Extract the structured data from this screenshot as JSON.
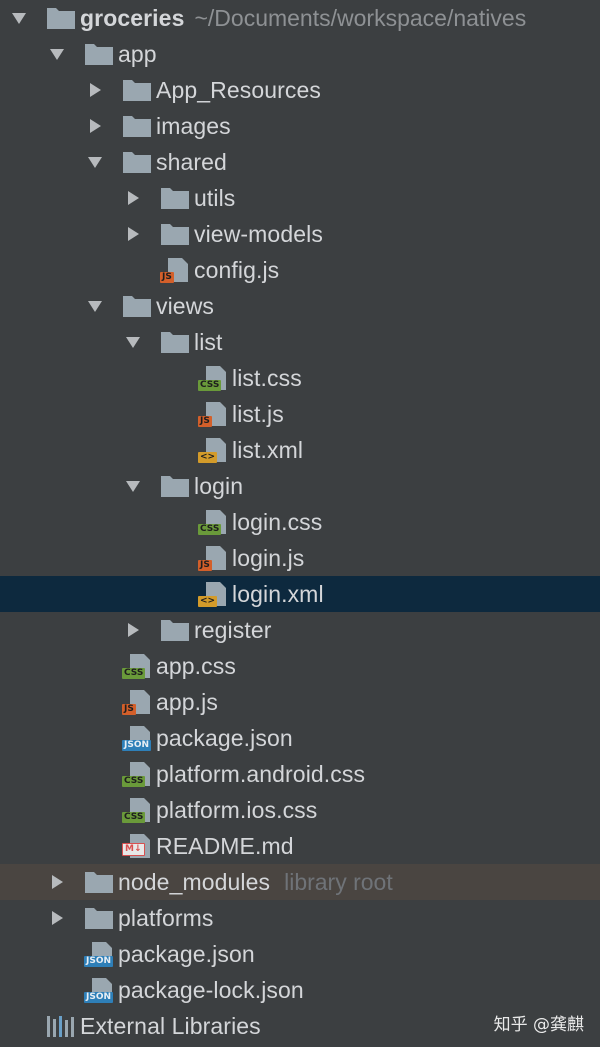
{
  "colors": {
    "background": "#3c3f41",
    "selected_row": "#0d293e",
    "library_root_row": "#4a4541",
    "folder": "#9aa7b0",
    "css_badge": "#6a9a3a",
    "js_badge": "#d35f2a",
    "xml_badge": "#d39b2a",
    "json_badge": "#2e7fb8",
    "md_badge": "#d85050"
  },
  "project": {
    "name": "groceries",
    "path": "~/Documents/workspace/natives"
  },
  "tree": [
    {
      "label": "app",
      "icon": "folder-icon",
      "expanded": true
    },
    {
      "label": "App_Resources",
      "icon": "folder-icon",
      "expanded": false
    },
    {
      "label": "images",
      "icon": "folder-icon",
      "expanded": false
    },
    {
      "label": "shared",
      "icon": "folder-icon",
      "expanded": true
    },
    {
      "label": "utils",
      "icon": "folder-icon",
      "expanded": false
    },
    {
      "label": "view-models",
      "icon": "folder-icon",
      "expanded": false
    },
    {
      "label": "config.js",
      "icon": "js-file-icon",
      "badge": "JS"
    },
    {
      "label": "views",
      "icon": "folder-icon",
      "expanded": true
    },
    {
      "label": "list",
      "icon": "folder-icon",
      "expanded": true
    },
    {
      "label": "list.css",
      "icon": "css-file-icon",
      "badge": "CSS"
    },
    {
      "label": "list.js",
      "icon": "js-file-icon",
      "badge": "JS"
    },
    {
      "label": "list.xml",
      "icon": "xml-file-icon",
      "badge": "<>"
    },
    {
      "label": "login",
      "icon": "folder-icon",
      "expanded": true
    },
    {
      "label": "login.css",
      "icon": "css-file-icon",
      "badge": "CSS"
    },
    {
      "label": "login.js",
      "icon": "js-file-icon",
      "badge": "JS"
    },
    {
      "label": "login.xml",
      "icon": "xml-file-icon",
      "badge": "<>",
      "selected": true
    },
    {
      "label": "register",
      "icon": "folder-icon",
      "expanded": false
    },
    {
      "label": "app.css",
      "icon": "css-file-icon",
      "badge": "CSS"
    },
    {
      "label": "app.js",
      "icon": "js-file-icon",
      "badge": "JS"
    },
    {
      "label": "package.json",
      "icon": "json-file-icon",
      "badge": "JSON"
    },
    {
      "label": "platform.android.css",
      "icon": "css-file-icon",
      "badge": "CSS"
    },
    {
      "label": "platform.ios.css",
      "icon": "css-file-icon",
      "badge": "CSS"
    },
    {
      "label": "README.md",
      "icon": "markdown-file-icon",
      "badge": "M↓"
    },
    {
      "label": "node_modules",
      "icon": "folder-icon",
      "expanded": false,
      "suffix": "library root"
    },
    {
      "label": "platforms",
      "icon": "folder-icon",
      "expanded": false
    },
    {
      "label": "package.json",
      "icon": "json-file-icon",
      "badge": "JSON"
    },
    {
      "label": "package-lock.json",
      "icon": "json-file-icon",
      "badge": "JSON"
    }
  ],
  "external_libraries": {
    "label": "External Libraries",
    "icon": "library-icon"
  },
  "watermark": "知乎 @龚麒"
}
